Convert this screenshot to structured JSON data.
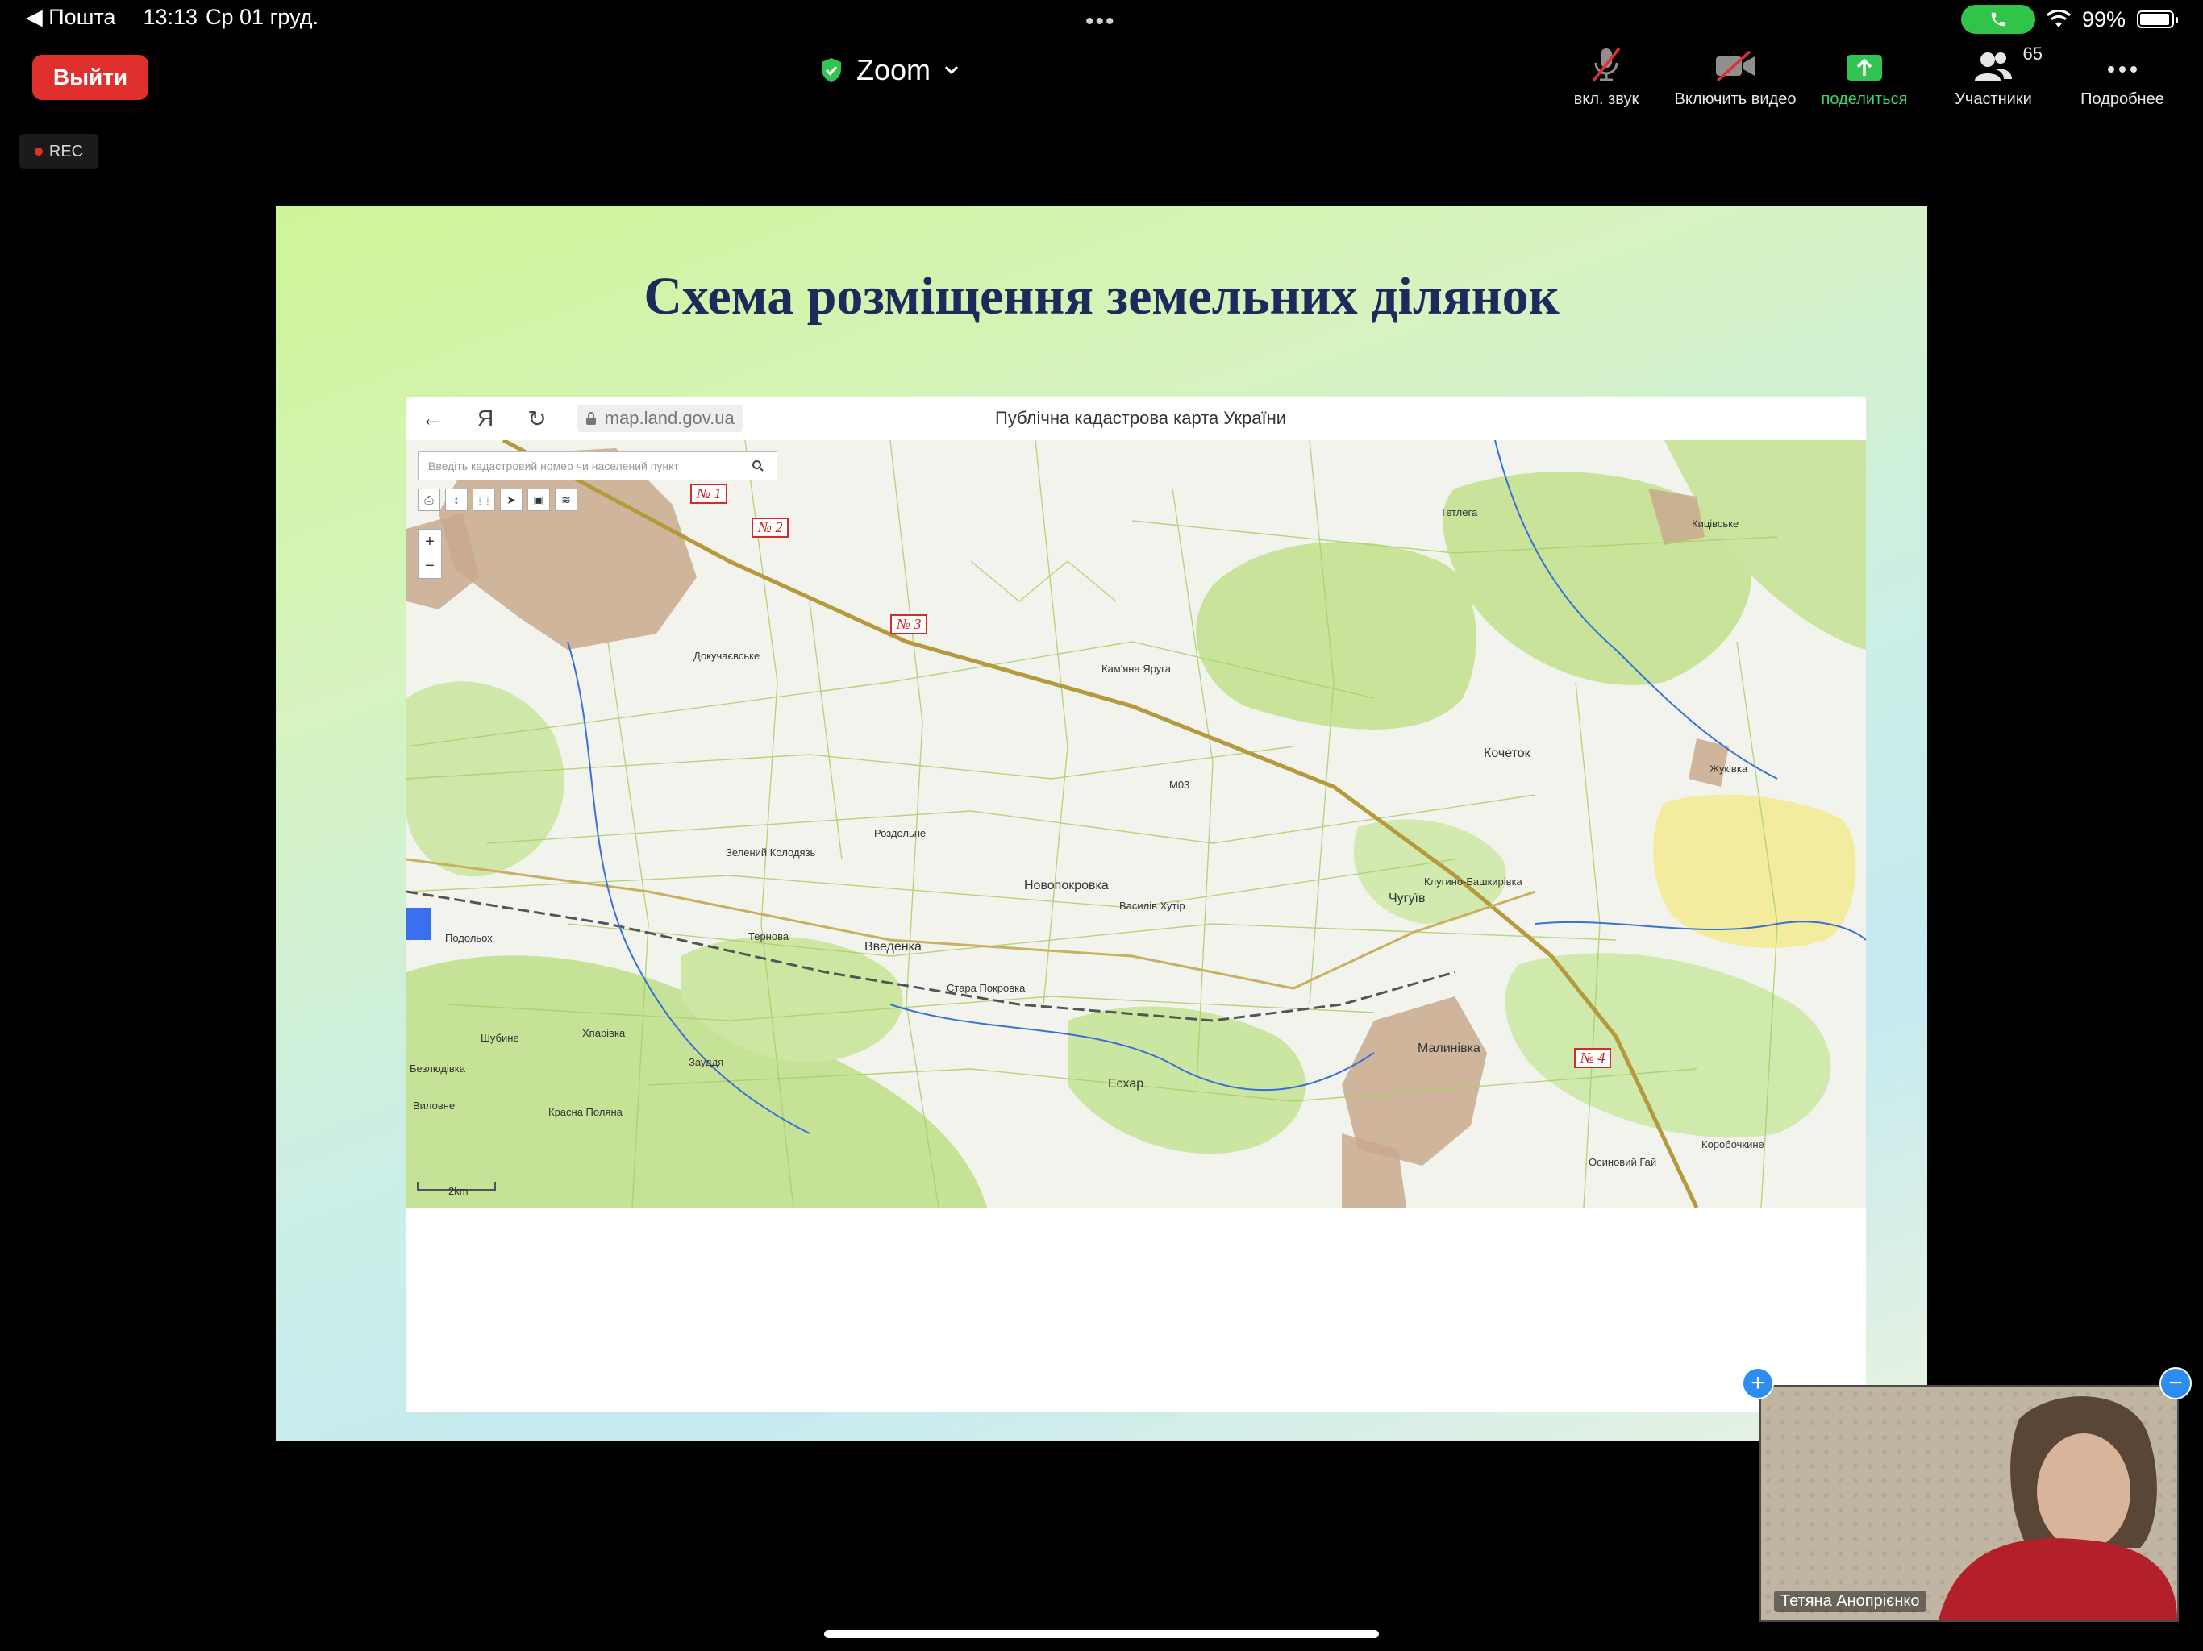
{
  "status_bar": {
    "back_app": "◀ Пошта",
    "time": "13:13",
    "date": "Ср 01 груд.",
    "battery": "99%",
    "battery_level": 0.99
  },
  "zoom_bar": {
    "leave_label": "Выйти",
    "title": "Zoom",
    "tools": {
      "audio": "вкл. звук",
      "video": "Включить видео",
      "share": "поделиться",
      "participants": "Участники",
      "participants_count": "65",
      "more": "Подробнее"
    },
    "rec_label": "REC"
  },
  "slide": {
    "title": "Схема розміщення земельних ділянок",
    "browser": {
      "url": "map.land.gov.ua",
      "yandex_glyph": "Я",
      "page_title": "Публічна кадастрова карта України",
      "search_placeholder": "Введіть кадастровий номер чи населений пункт"
    },
    "markers": [
      "№ 1",
      "№ 2",
      "№ 3",
      "№ 4"
    ],
    "places": {
      "tetlega": "Тетлега",
      "kyianytske": "Кицівське",
      "kamiana_yaruga": "Кам'яна Яруга",
      "dokuchaievske": "Докучаєвське",
      "kochetok": "Кочеток",
      "zhuravka": "Жуківка",
      "rozdolne": "Роздольне",
      "zelenyi_kolodiaz": "Зелений Колодязь",
      "novopokrovka": "Новопокровка",
      "vasyliv_khutir": "Василів Хутір",
      "chuhuiv": "Чугуїв",
      "kochuhino": "Клугино-Башкирівка",
      "ternova": "Тернова",
      "vvedenka": "Введенка",
      "stara_pokrovka": "Стара Покровка",
      "malynivka": "Малинівка",
      "eskhar": "Есхар",
      "zaudzhe": "Зауддя",
      "osynovyi_hai": "Осиновий Гай",
      "korobochkyne": "Коробочкине",
      "podolkh": "Подольох",
      "shubyne": "Шубине",
      "krasna_poliana": "Красна Поляна",
      "vilkhuvatka": "Хпарівка",
      "bezliudivka": "Безлюдівка",
      "ykroyne": "Виловне"
    },
    "road_label": "М03",
    "scale_label": "2km"
  },
  "self_view": {
    "name": "Тетяна Анопрієнко"
  }
}
